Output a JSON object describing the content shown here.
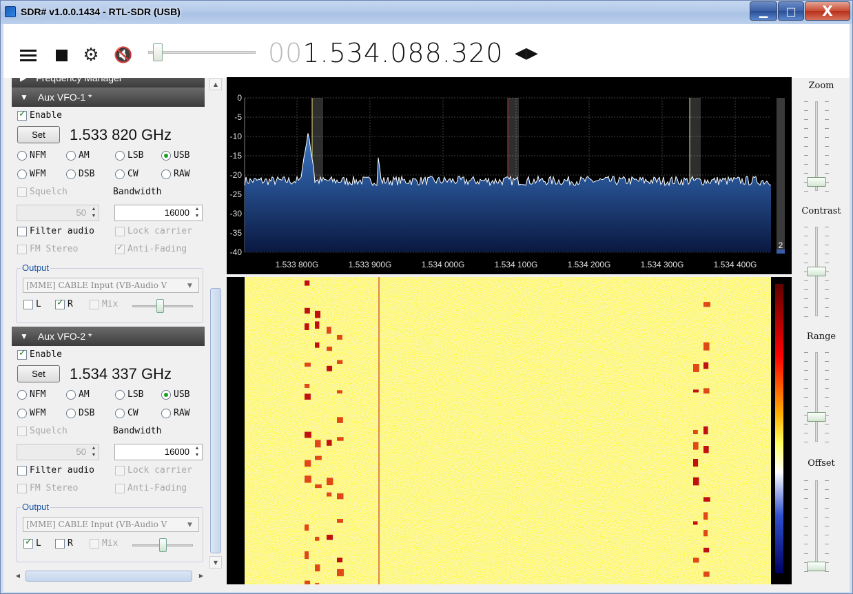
{
  "window": {
    "title": "SDR# v1.0.0.1434 - RTL-SDR (USB)",
    "min_label": "▁",
    "max_label": "□",
    "close_label": "X"
  },
  "toolbar": {
    "freq_lead": "00",
    "freq_main": "1.534.088.320",
    "tune_arrows": "◀▶",
    "volume_level": 0.05
  },
  "panel": {
    "partial_header": "Frequency Manager",
    "vfos": [
      {
        "header": "Aux VFO-1 *",
        "enable_label": "Enable",
        "enable": true,
        "set_label": "Set",
        "frequency": "1.533 820 GHz",
        "modes": [
          "NFM",
          "AM",
          "LSB",
          "USB",
          "WFM",
          "DSB",
          "CW",
          "RAW"
        ],
        "selected_mode": "USB",
        "squelch_label": "Squelch",
        "bandwidth_label": "Bandwidth",
        "squelch_value": "50",
        "bandwidth_value": "16000",
        "filter_audio_label": "Filter audio",
        "lock_carrier_label": "Lock carrier",
        "fm_stereo_label": "FM Stereo",
        "anti_fading_label": "Anti-Fading",
        "anti_fading": true,
        "output_label": "Output",
        "output_device": "[MME] CABLE Input (VB-Audio V",
        "left_label": "L",
        "right_label": "R",
        "mix_label": "Mix",
        "left": false,
        "right": true,
        "balance": 0.45
      },
      {
        "header": "Aux VFO-2 *",
        "enable_label": "Enable",
        "enable": true,
        "set_label": "Set",
        "frequency": "1.534 337 GHz",
        "modes": [
          "NFM",
          "AM",
          "LSB",
          "USB",
          "WFM",
          "DSB",
          "CW",
          "RAW"
        ],
        "selected_mode": "USB",
        "squelch_label": "Squelch",
        "bandwidth_label": "Bandwidth",
        "squelch_value": "50",
        "bandwidth_value": "16000",
        "filter_audio_label": "Filter audio",
        "lock_carrier_label": "Lock carrier",
        "fm_stereo_label": "FM Stereo",
        "anti_fading_label": "Anti-Fading",
        "anti_fading": false,
        "output_label": "Output",
        "output_device": "[MME] CABLE Input (VB-Audio V",
        "left_label": "L",
        "right_label": "R",
        "mix_label": "Mix",
        "left": true,
        "right": false,
        "balance": 0.5
      }
    ]
  },
  "spectrum": {
    "y_ticks": [
      "0",
      "-5",
      "-10",
      "-15",
      "-20",
      "-25",
      "-30",
      "-35",
      "-40"
    ],
    "x_ticks": [
      "1.533 800G",
      "1.533 900G",
      "1.534 000G",
      "1.534 100G",
      "1.534 200G",
      "1.534 300G",
      "1.534 400G"
    ],
    "gain_label": "2",
    "colors": {
      "background": "#000000",
      "trace": "#ffffff",
      "fill_top": "#3a78c8",
      "fill_bottom": "#0a1840",
      "vfo_marker": "#e8e07a",
      "center_marker": "#d03030"
    }
  },
  "right_panel": {
    "zoom_label": "Zoom",
    "contrast_label": "Contrast",
    "range_label": "Range",
    "offset_label": "Offset",
    "zoom_level": 0.05,
    "contrast_level": 0.5,
    "range_level": 0.25,
    "offset_level": 0.0
  }
}
